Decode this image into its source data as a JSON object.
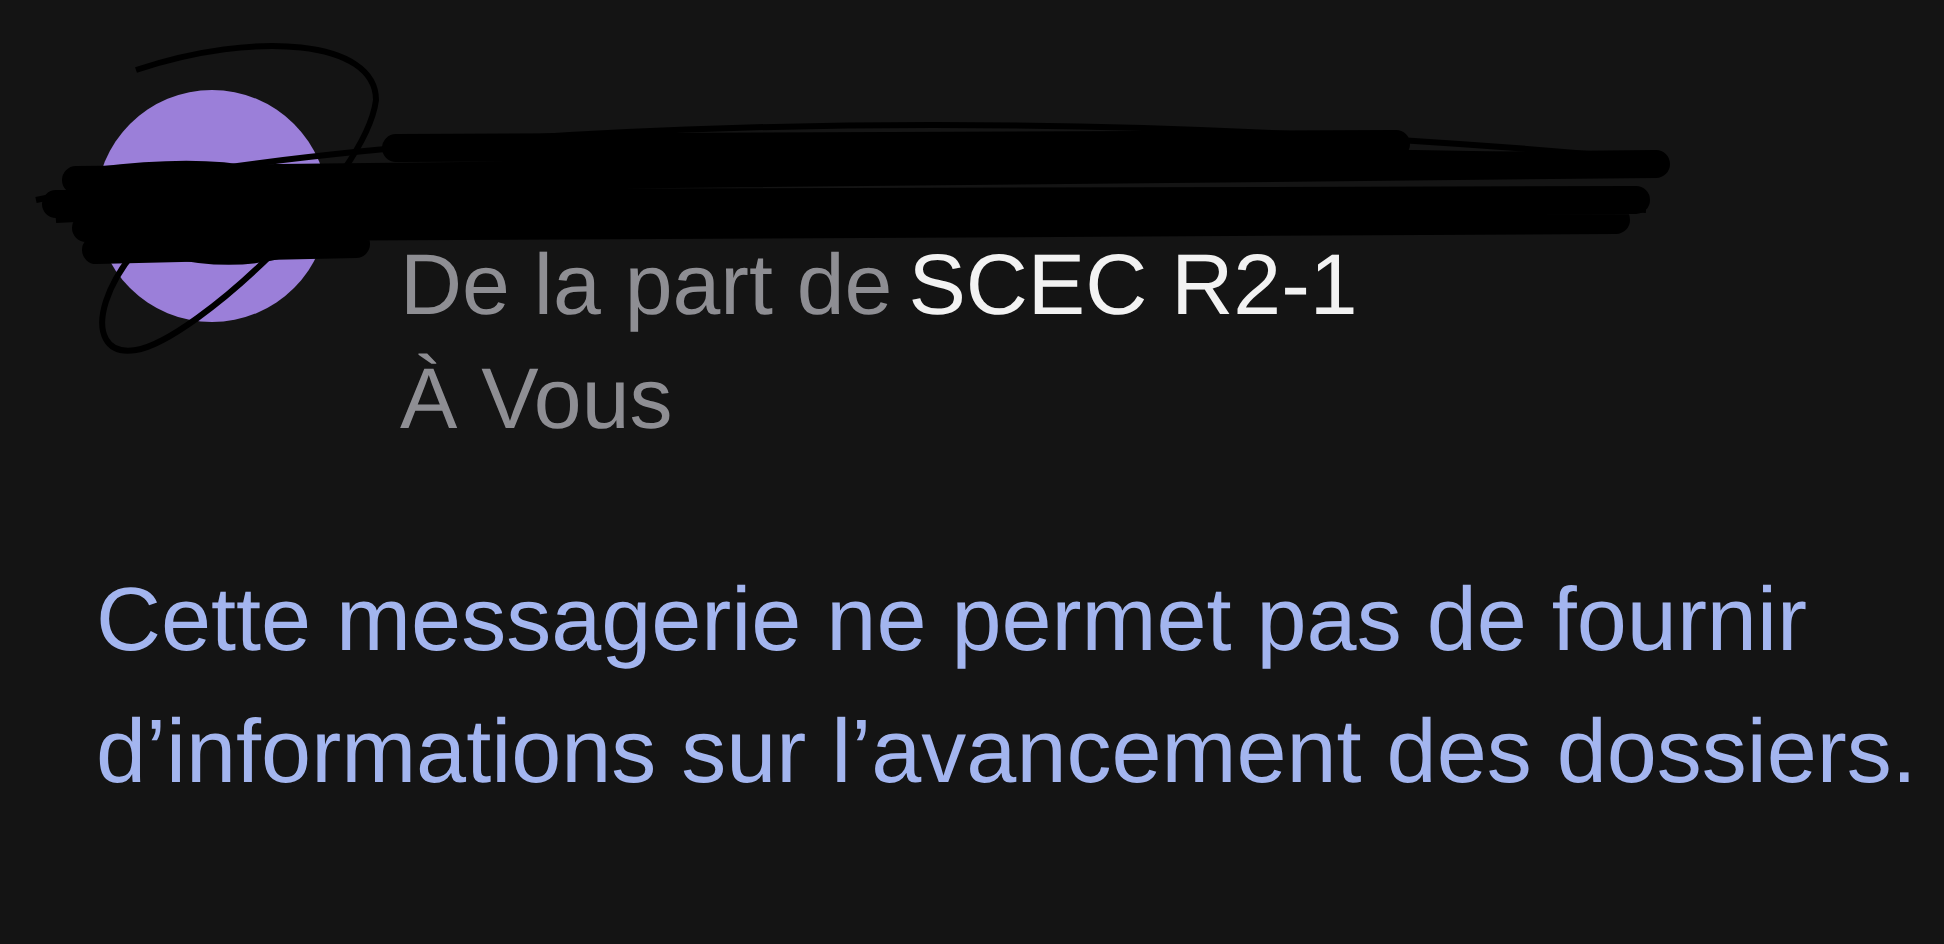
{
  "sender": {
    "prefix": "De la part de",
    "name": "SCEC R2-1"
  },
  "recipient": "À Vous",
  "body": "Cette messagerie ne permet pas de fournir d’informations sur l’avancement des dossiers."
}
